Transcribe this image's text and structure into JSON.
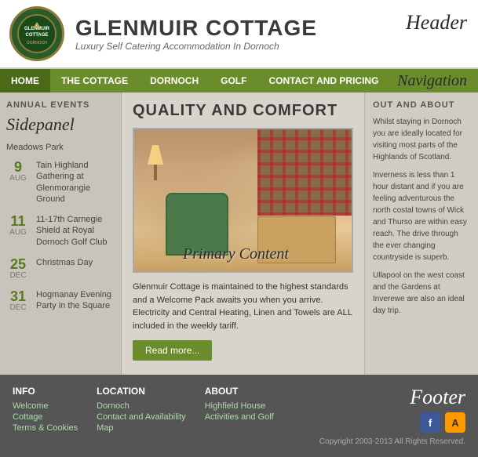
{
  "header": {
    "title": "GLENMUIR COTTAGE",
    "subtitle": "Luxury Self Catering Accommodation In Dornoch",
    "label": "Header"
  },
  "nav": {
    "label": "Navigation",
    "items": [
      {
        "id": "home",
        "label": "HOME",
        "active": true
      },
      {
        "id": "cottage",
        "label": "THE COTTAGE",
        "active": false
      },
      {
        "id": "dornoch",
        "label": "DORNOCH",
        "active": false
      },
      {
        "id": "golf",
        "label": "GOLF",
        "active": false
      },
      {
        "id": "contact",
        "label": "CONTACT AND PRICING",
        "active": false
      }
    ]
  },
  "sidebar": {
    "label": "Sidepanel",
    "section_title": "ANNUAL EVENTS",
    "intro_text": "Meadows Park",
    "events": [
      {
        "day": "9",
        "month": "Aug",
        "text": "Tain Highland Gathering at Glenmorangie Ground"
      },
      {
        "day": "11",
        "month": "Aug",
        "text": "11-17th Carnegie Shield at Royal Dornoch Golf Club"
      },
      {
        "day": "25",
        "month": "Dec",
        "text": "Christmas Day"
      },
      {
        "day": "31",
        "month": "Dec",
        "text": "Hogmanay Evening Party in the Square"
      }
    ]
  },
  "content": {
    "title": "QUALITY AND COMFORT",
    "description": "Glenmuir Cottage is maintained to the highest standards and a Welcome Pack awaits you when you arrive. Electricity and Central Heating, Linen and Towels are ALL included in the weekly tariff.",
    "read_more_label": "Read more...",
    "primary_label": "Primary Content"
  },
  "outabout": {
    "title": "OUT AND ABOUT",
    "paragraphs": [
      "Whilst staying in Dornoch you are ideally located for visiting most parts of the Highlands of Scotland.",
      "Inverness is less than 1 hour distant and if you are feeling adventurous the north costal towns of Wick and Thurso are within easy reach. The drive through the ever changing countryside is superb.",
      "Ullapool on the west coast and the Gardens at Inverewe are also an ideal day trip."
    ]
  },
  "footer": {
    "label": "Footer",
    "copyright": "Copyright 2003-2013 All Rights Reserved.",
    "cols": [
      {
        "title": "INFO",
        "links": [
          "Welcome",
          "Cottage",
          "Terms & Cookies"
        ]
      },
      {
        "title": "LOCATION",
        "links": [
          "Dornoch",
          "Contact and Availability",
          "Map"
        ]
      },
      {
        "title": "ABOUT",
        "links": [
          "Highfield House",
          "Activities and Golf"
        ]
      }
    ],
    "social": [
      {
        "name": "Facebook",
        "letter": "f"
      },
      {
        "name": "Amazon",
        "letter": "A"
      }
    ]
  }
}
